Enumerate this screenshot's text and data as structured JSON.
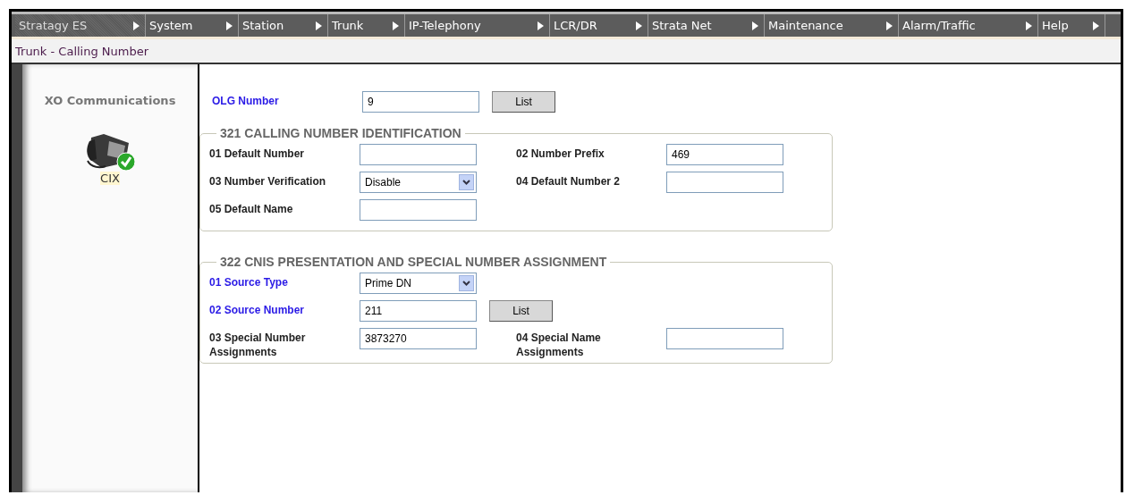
{
  "menu": [
    {
      "label": "Stratagy ES",
      "selected": true
    },
    {
      "label": "System",
      "selected": false
    },
    {
      "label": "Station",
      "selected": false
    },
    {
      "label": "Trunk",
      "selected": false
    },
    {
      "label": "IP-Telephony",
      "selected": false
    },
    {
      "label": "LCR/DR",
      "selected": false
    },
    {
      "label": "Strata Net",
      "selected": false
    },
    {
      "label": "Maintenance",
      "selected": false
    },
    {
      "label": "Alarm/Traffic",
      "selected": false
    },
    {
      "label": "Help",
      "selected": false
    }
  ],
  "breadcrumb": "Trunk - Calling Number",
  "sidebar": {
    "title": "XO Communications",
    "device": {
      "label": "CIX",
      "online": true
    }
  },
  "olg": {
    "label": "OLG Number",
    "link": true,
    "kind": "text",
    "value": "9",
    "button": "List"
  },
  "sections": [
    {
      "title": "321 CALLING NUMBER IDENTIFICATION",
      "rows": [
        [
          {
            "label": "01 Default Number",
            "link": false,
            "kind": "text"
          },
          {
            "label": "02 Number Prefix",
            "link": false,
            "kind": "text",
            "value": "469"
          }
        ],
        [
          {
            "label": "03 Number Verification",
            "link": false,
            "kind": "select",
            "value": "Disable"
          },
          {
            "label": "04 Default Number 2",
            "link": false,
            "kind": "text"
          }
        ],
        [
          {
            "label": "05 Default Name",
            "link": false,
            "kind": "text"
          }
        ]
      ]
    },
    {
      "title": "322 CNIS PRESENTATION AND SPECIAL NUMBER ASSIGNMENT",
      "rows": [
        [
          {
            "label": "01 Source Type",
            "link": true,
            "kind": "select",
            "value": "Prime DN"
          }
        ],
        [
          {
            "label": "02 Source Number",
            "link": true,
            "kind": "text",
            "value": "211",
            "button": "List"
          }
        ],
        [
          {
            "label": "03 Special Number Assignments",
            "link": false,
            "kind": "text",
            "value": "3873270"
          },
          {
            "label": "04 Special Name Assignments",
            "link": false,
            "kind": "text"
          }
        ]
      ]
    }
  ]
}
